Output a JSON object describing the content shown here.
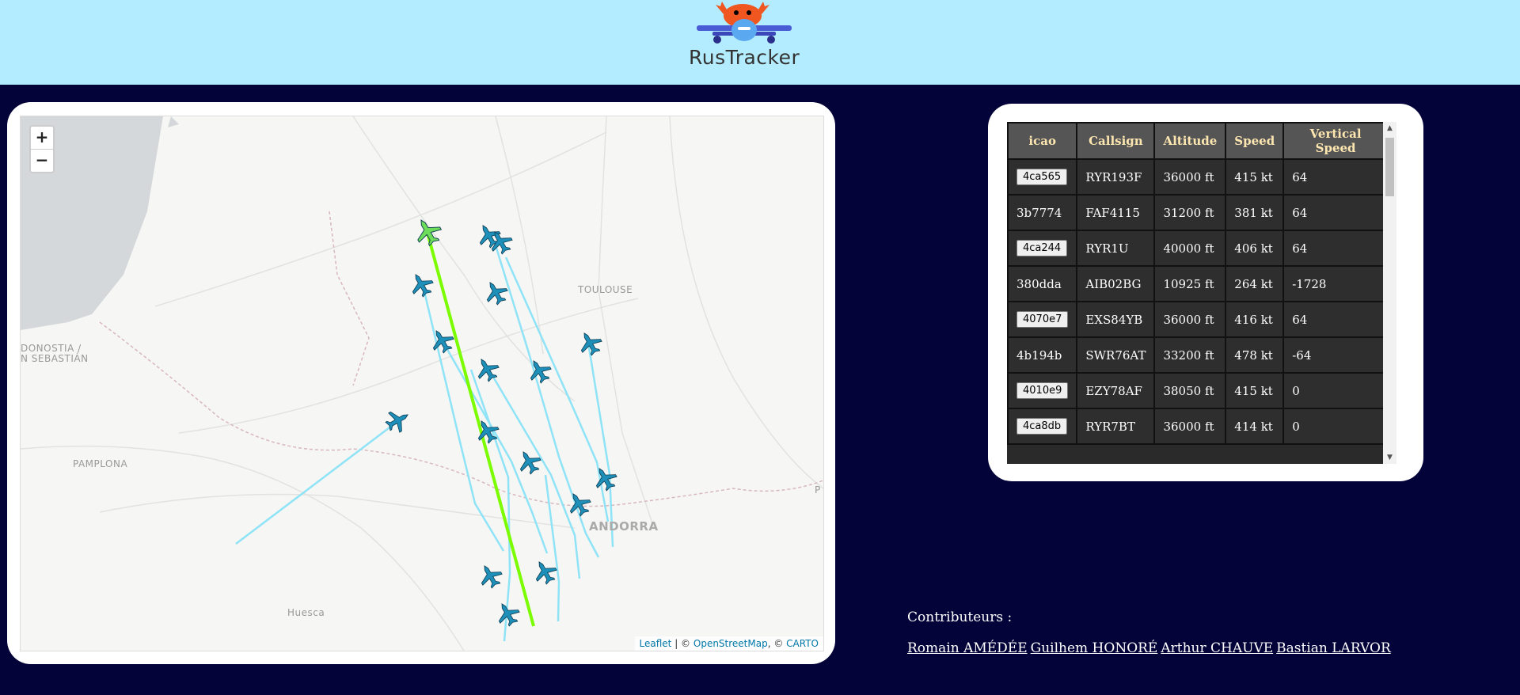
{
  "header": {
    "logo_text": "RusTracker",
    "background": "#b3ecfe"
  },
  "map": {
    "zoom_in": "+",
    "zoom_out": "−",
    "attribution": {
      "leaflet": "Leaflet",
      "sep1": " | © ",
      "osm": "OpenStreetMap",
      "sep2": ", © ",
      "carto": "CARTO"
    },
    "places": {
      "toulouse": "TOULOUSE",
      "donostia1": "DONOSTIA /",
      "donostia2": "N SEBASTIÁN",
      "pamplona": "PAMPLONA",
      "andorra": "ANDORRA",
      "huesca": "Huesca",
      "edge_p": "P"
    },
    "selected_color": "#7cfc00",
    "track_color": "#8fe3f7",
    "plane_color": "#1e8fb8"
  },
  "table": {
    "headers": [
      "icao",
      "Callsign",
      "Altitude",
      "Speed",
      "Vertical Speed"
    ],
    "rows": [
      {
        "icao": "4ca565",
        "button": true,
        "callsign": "RYR193F",
        "altitude": "36000 ft",
        "speed": "415 kt",
        "vs": "64"
      },
      {
        "icao": "3b7774",
        "button": false,
        "callsign": "FAF4115",
        "altitude": "31200 ft",
        "speed": "381 kt",
        "vs": "64"
      },
      {
        "icao": "4ca244",
        "button": true,
        "callsign": "RYR1U",
        "altitude": "40000 ft",
        "speed": "406 kt",
        "vs": "64"
      },
      {
        "icao": "380dda",
        "button": false,
        "callsign": "AIB02BG",
        "altitude": "10925 ft",
        "speed": "264 kt",
        "vs": "-1728"
      },
      {
        "icao": "4070e7",
        "button": true,
        "callsign": "EXS84YB",
        "altitude": "36000 ft",
        "speed": "416 kt",
        "vs": "64"
      },
      {
        "icao": "4b194b",
        "button": false,
        "callsign": "SWR76AT",
        "altitude": "33200 ft",
        "speed": "478 kt",
        "vs": "-64"
      },
      {
        "icao": "4010e9",
        "button": true,
        "callsign": "EZY78AF",
        "altitude": "38050 ft",
        "speed": "415 kt",
        "vs": "0"
      },
      {
        "icao": "4ca8db",
        "button": true,
        "callsign": "RYR7BT",
        "altitude": "36000 ft",
        "speed": "414 kt",
        "vs": "0"
      }
    ]
  },
  "contributors": {
    "title": "Contributeurs :",
    "names": [
      "Romain AMÉDÉE",
      "Guilhem HONORÉ",
      "Arthur CHAUVE",
      "Bastian LARVOR"
    ]
  }
}
